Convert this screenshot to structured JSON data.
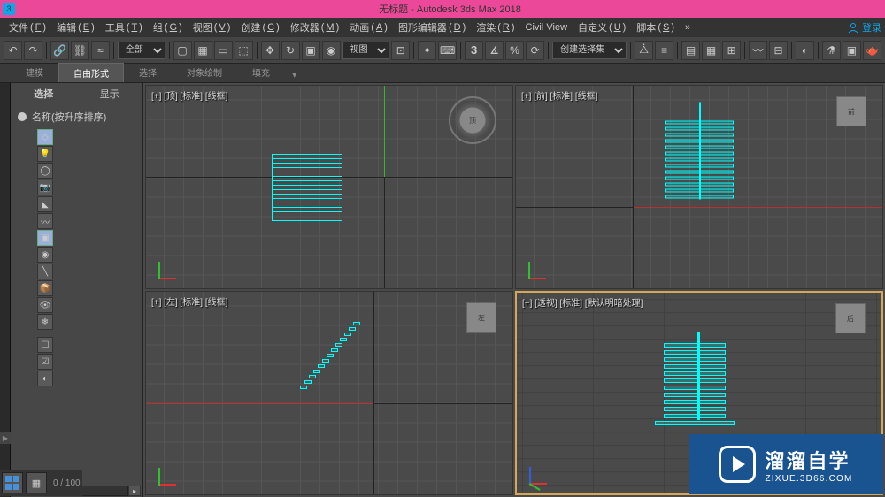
{
  "titlebar": {
    "app_icon": "3",
    "title": "无标题 - Autodesk 3ds Max 2018"
  },
  "menubar": {
    "items": [
      {
        "label": "文件",
        "key": "F"
      },
      {
        "label": "编辑",
        "key": "E"
      },
      {
        "label": "工具",
        "key": "T"
      },
      {
        "label": "组",
        "key": "G"
      },
      {
        "label": "视图",
        "key": "V"
      },
      {
        "label": "创建",
        "key": "C"
      },
      {
        "label": "修改器",
        "key": "M"
      },
      {
        "label": "动画",
        "key": "A"
      },
      {
        "label": "图形编辑器",
        "key": "D"
      },
      {
        "label": "渲染",
        "key": "R"
      },
      {
        "label": "Civil View",
        "key": ""
      },
      {
        "label": "自定义",
        "key": "U"
      },
      {
        "label": "脚本",
        "key": "S"
      }
    ],
    "login": "登录"
  },
  "toolbar": {
    "filter_all": "全部",
    "view_dropdown": "视图",
    "selection_set": "创建选择集"
  },
  "ribbon": {
    "tabs": [
      "建模",
      "自由形式",
      "选择",
      "对象绘制",
      "填充"
    ]
  },
  "scene_panel": {
    "tabs": [
      "选择",
      "显示"
    ],
    "header": "名称(按升序排序)"
  },
  "viewports": {
    "top": "[+] [顶] [标准] [线框]",
    "front": "[+] [前] [标准] [线框]",
    "left": "[+] [左] [标准] [线框]",
    "perspective": "[+] [透视] [标准] [默认明暗处理]",
    "cube_top": "顶",
    "cube_front": "前",
    "cube_left": "左",
    "cube_persp": "后"
  },
  "watermark": {
    "title": "溜溜自学",
    "url": "ZIXUE.3D66.COM"
  },
  "status": {
    "frames": "0 / 100"
  },
  "chart_data": {
    "type": "other",
    "object": "stairs",
    "steps": 13,
    "color": "#00ffff"
  }
}
